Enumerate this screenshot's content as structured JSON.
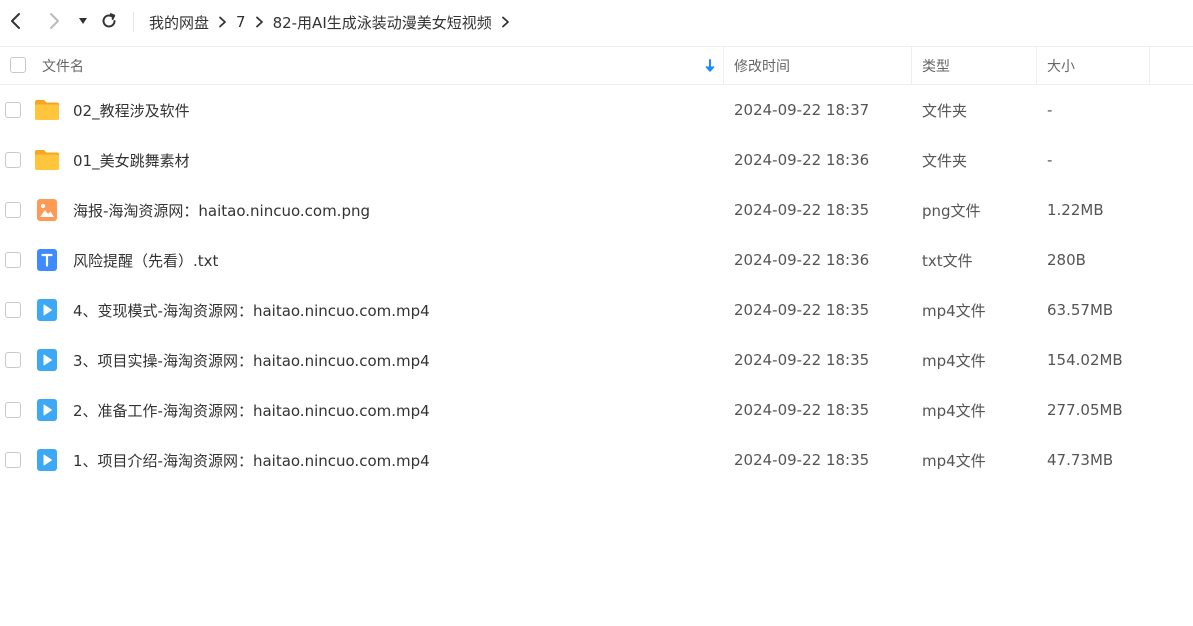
{
  "toolbar": {
    "back_icon": "chevron-left-icon",
    "forward_icon": "chevron-right-icon",
    "history_icon": "caret-down-icon",
    "refresh_icon": "refresh-icon"
  },
  "breadcrumb": [
    {
      "label": "我的网盘"
    },
    {
      "label": "7"
    },
    {
      "label": "82-用AI生成泳装动漫美女短视频"
    }
  ],
  "header": {
    "name": "文件名",
    "modified": "修改时间",
    "type": "类型",
    "size": "大小",
    "sort_icon": "sort-down-arrow-icon"
  },
  "colors": {
    "folder": "#FFC53D",
    "image": "#FF9A56",
    "text": "#3D8BFF",
    "video": "#3DA8F5",
    "sort_accent": "#1A8CFF"
  },
  "files": [
    {
      "name": "02_教程涉及软件",
      "time": "2024-09-22 18:37",
      "type": "文件夹",
      "size": "-",
      "icon": "folder"
    },
    {
      "name": "01_美女跳舞素材",
      "time": "2024-09-22 18:36",
      "type": "文件夹",
      "size": "-",
      "icon": "folder"
    },
    {
      "name": "海报-海淘资源网：haitao.nincuo.com.png",
      "time": "2024-09-22 18:35",
      "type": "png文件",
      "size": "1.22MB",
      "icon": "image"
    },
    {
      "name": "风险提醒（先看）.txt",
      "time": "2024-09-22 18:36",
      "type": "txt文件",
      "size": "280B",
      "icon": "text"
    },
    {
      "name": "4、变现模式-海淘资源网：haitao.nincuo.com.mp4",
      "time": "2024-09-22 18:35",
      "type": "mp4文件",
      "size": "63.57MB",
      "icon": "video"
    },
    {
      "name": "3、项目实操-海淘资源网：haitao.nincuo.com.mp4",
      "time": "2024-09-22 18:35",
      "type": "mp4文件",
      "size": "154.02MB",
      "icon": "video"
    },
    {
      "name": "2、准备工作-海淘资源网：haitao.nincuo.com.mp4",
      "time": "2024-09-22 18:35",
      "type": "mp4文件",
      "size": "277.05MB",
      "icon": "video"
    },
    {
      "name": "1、项目介绍-海淘资源网：haitao.nincuo.com.mp4",
      "time": "2024-09-22 18:35",
      "type": "mp4文件",
      "size": "47.73MB",
      "icon": "video"
    }
  ]
}
